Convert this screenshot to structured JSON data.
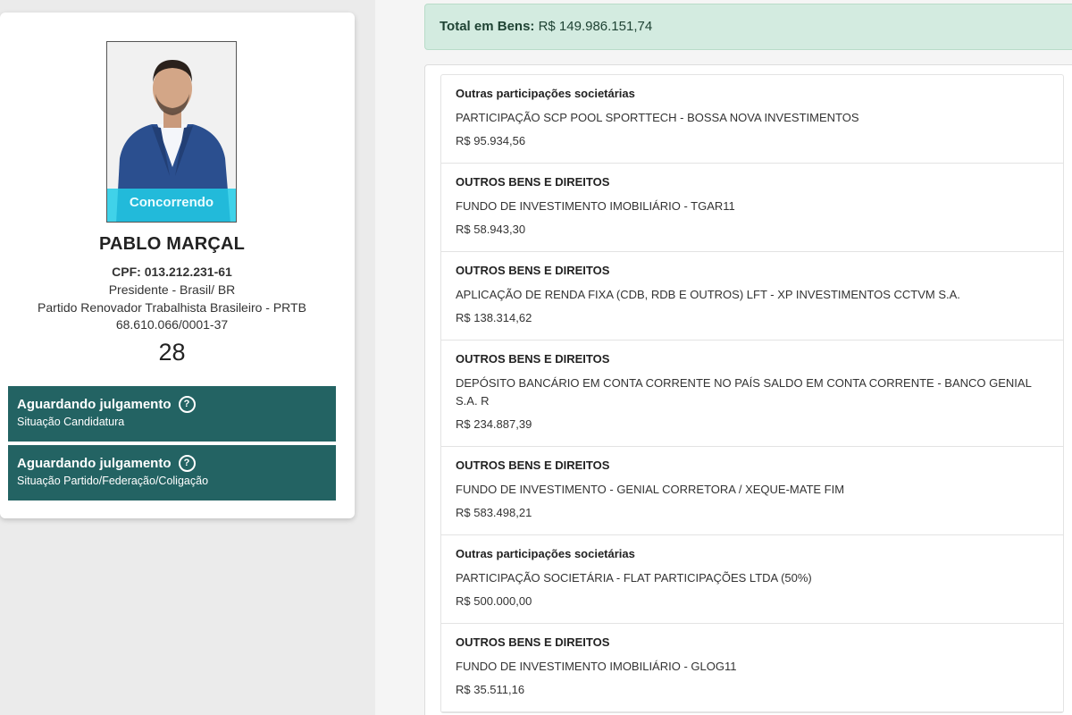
{
  "candidate": {
    "status_ribbon": "Concorrendo",
    "name": "PABLO MARÇAL",
    "cpf": "CPF: 013.212.231-61",
    "role": "Presidente - Brasil/ BR",
    "party": "Partido Renovador Trabalhista Brasileiro - PRTB",
    "party_cnpj": "68.610.066/0001-37",
    "number": "28",
    "statuses": [
      {
        "title": "Aguardando julgamento",
        "subtitle": "Situação Candidatura",
        "icon": "help-circle-icon"
      },
      {
        "title": "Aguardando julgamento",
        "subtitle": "Situação Partido/Federação/Coligação",
        "icon": "help-circle-icon"
      }
    ],
    "colors": {
      "status_box": "#236363",
      "ribbon": "#21cde8"
    }
  },
  "assets": {
    "total_label": "Total em Bens:",
    "total_value": "R$ 149.986.151,74",
    "items": [
      {
        "type": "Outras participações societárias",
        "description": "PARTICIPAÇÃO SCP POOL SPORTTECH - BOSSA NOVA INVESTIMENTOS",
        "value": "R$ 95.934,56"
      },
      {
        "type": "OUTROS BENS E DIREITOS",
        "description": "FUNDO DE INVESTIMENTO IMOBILIÁRIO - TGAR11",
        "value": "R$ 58.943,30"
      },
      {
        "type": "OUTROS BENS E DIREITOS",
        "description": "APLICAÇÃO DE RENDA FIXA (CDB, RDB E OUTROS) LFT - XP INVESTIMENTOS CCTVM S.A.",
        "value": "R$ 138.314,62"
      },
      {
        "type": "OUTROS BENS E DIREITOS",
        "description": "DEPÓSITO BANCÁRIO EM CONTA CORRENTE NO PAÍS SALDO EM CONTA CORRENTE - BANCO GENIAL S.A. R",
        "value": "R$ 234.887,39"
      },
      {
        "type": "OUTROS BENS E DIREITOS",
        "description": "FUNDO DE INVESTIMENTO - GENIAL CORRETORA / XEQUE-MATE FIM",
        "value": "R$ 583.498,21"
      },
      {
        "type": "Outras participações societárias",
        "description": "PARTICIPAÇÃO SOCIETÁRIA - FLAT PARTICIPAÇÕES LTDA (50%)",
        "value": "R$ 500.000,00"
      },
      {
        "type": "OUTROS BENS E DIREITOS",
        "description": "FUNDO DE INVESTIMENTO IMOBILIÁRIO - GLOG11",
        "value": "R$ 35.511,16"
      }
    ],
    "colors": {
      "total_bg": "#d3ebe0"
    }
  }
}
